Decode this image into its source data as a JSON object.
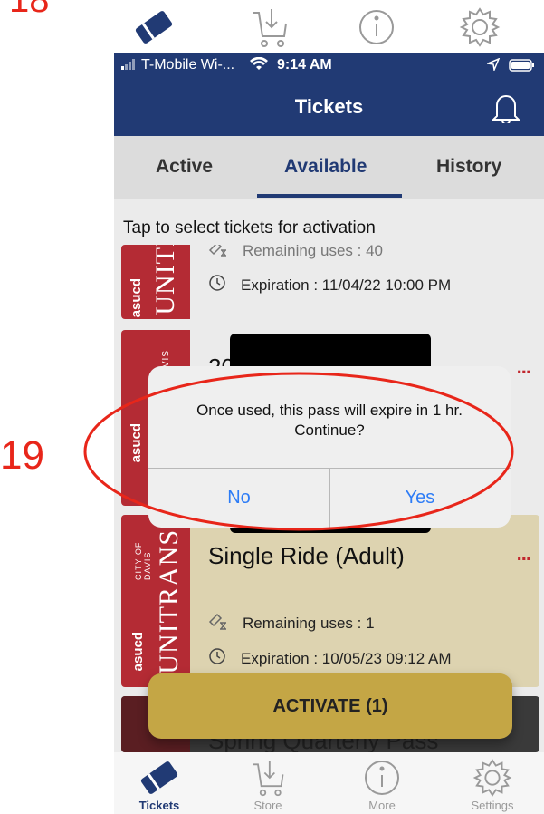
{
  "annotations": {
    "top_step": "18",
    "step": "19"
  },
  "status_bar": {
    "carrier": "T-Mobile Wi-...",
    "time": "9:14 AM"
  },
  "header": {
    "title": "Tickets"
  },
  "tabs": [
    {
      "label": "Active"
    },
    {
      "label": "Available"
    },
    {
      "label": "History"
    }
  ],
  "hint": "Tap to select tickets for activation",
  "cards": [
    {
      "remaining": "Remaining uses : 40",
      "expiration": "Expiration : 11/04/22 10:00 PM"
    },
    {
      "title": "20",
      "dots": "..."
    },
    {
      "title": "Single Ride (Adult)",
      "dots": "...",
      "remaining": "Remaining uses : 1",
      "expiration": "Expiration : 10/05/23 09:12 AM"
    },
    {
      "title": "Spring Quarterly Pass"
    }
  ],
  "brand": {
    "unitrans": "UNITRANS",
    "asucd": "asucd",
    "city": "CITY OF DAVIS"
  },
  "dialog": {
    "message": "Once used, this pass will expire in 1 hr. Continue?",
    "no": "No",
    "yes": "Yes"
  },
  "activate_label": "ACTIVATE (1)",
  "bottom_nav": [
    {
      "label": "Tickets"
    },
    {
      "label": "Store"
    },
    {
      "label": "More"
    },
    {
      "label": "Settings"
    }
  ],
  "colors": {
    "nav": "#213a74",
    "brand_red": "#b42b34",
    "activate": "#c4a645",
    "dialog_button": "#2d7cf6",
    "annotation": "#e8261a"
  }
}
